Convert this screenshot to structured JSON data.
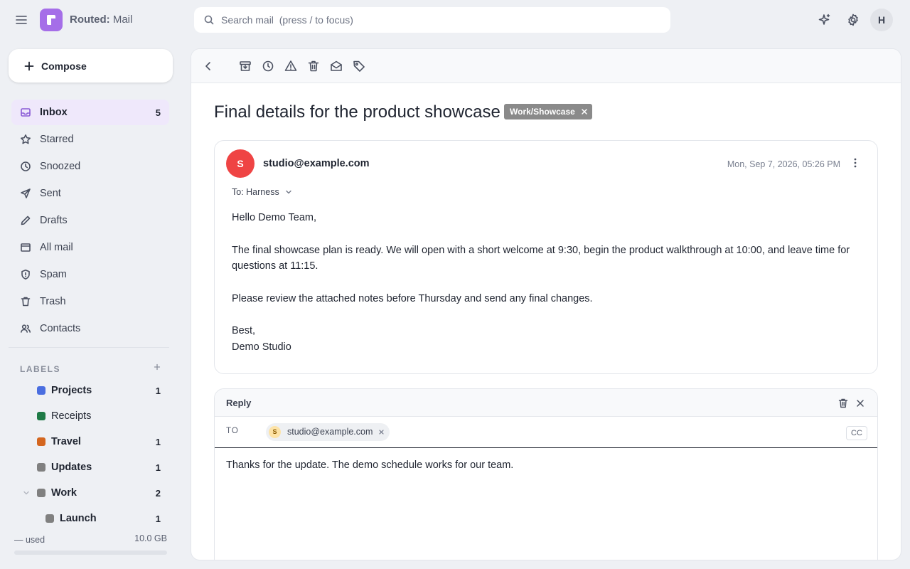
{
  "app": {
    "name_bold": "Routed:",
    "name_rest": " Mail",
    "logo_letter": "r",
    "brand_color": "#a56ee8"
  },
  "search": {
    "placeholder": "Search mail  (press / to focus)"
  },
  "header": {
    "user_initial": "H"
  },
  "compose": {
    "label": "Compose"
  },
  "nav": {
    "items": [
      {
        "label": "Inbox",
        "count": "5",
        "icon": "inbox-icon"
      },
      {
        "label": "Starred",
        "count": "",
        "icon": "star-icon"
      },
      {
        "label": "Snoozed",
        "count": "",
        "icon": "clock-icon"
      },
      {
        "label": "Sent",
        "count": "",
        "icon": "send-icon"
      },
      {
        "label": "Drafts",
        "count": "",
        "icon": "pencil-icon"
      },
      {
        "label": "All mail",
        "count": "",
        "icon": "archive-box-icon"
      },
      {
        "label": "Spam",
        "count": "",
        "icon": "shield-icon"
      },
      {
        "label": "Trash",
        "count": "",
        "icon": "trash-icon"
      },
      {
        "label": "Contacts",
        "count": "",
        "icon": "people-icon"
      }
    ]
  },
  "labels": {
    "heading": "LABELS",
    "items": [
      {
        "label": "Projects",
        "count": "1",
        "color": "#4a6ee0"
      },
      {
        "label": "Receipts",
        "count": "",
        "color": "#1e7a46"
      },
      {
        "label": "Travel",
        "count": "1",
        "color": "#d4661f"
      },
      {
        "label": "Updates",
        "count": "1",
        "color": "#808080"
      },
      {
        "label": "Work",
        "count": "2",
        "color": "#808080"
      },
      {
        "label": "Launch",
        "count": "1",
        "color": "#808080"
      }
    ]
  },
  "storage": {
    "used": "— used",
    "total": "10.0 GB"
  },
  "message": {
    "subject": "Final details for the product showcase",
    "tag": "Work/Showcase",
    "sender_initial": "S",
    "sender": "studio@example.com",
    "date": "Mon, Sep 7, 2026, 05:26 PM",
    "to_line": "To: Harness",
    "body": {
      "greeting": "Hello Demo Team,",
      "p1": "The final showcase plan is ready. We will open with a short welcome at 9:30, begin the product walkthrough at 10:00, and leave time for questions at 11:15.",
      "p2": "Please review the attached notes before Thursday and send any final changes.",
      "signoff": "Best,",
      "signature": "Demo Studio"
    }
  },
  "reply": {
    "title": "Reply",
    "to_label": "TO",
    "recipient_initial": "S",
    "recipient": "studio@example.com",
    "cc_label": "CC",
    "body": "Thanks for the update. The demo schedule works for our team."
  }
}
